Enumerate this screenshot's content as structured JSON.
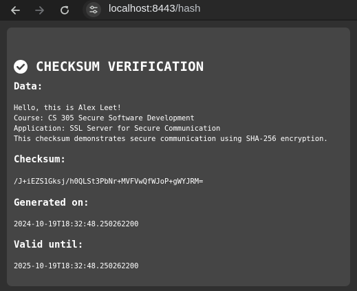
{
  "browser": {
    "host": "localhost:8443",
    "path": "/hash"
  },
  "page": {
    "title": "CHECKSUM VERIFICATION",
    "data_heading": "Data:",
    "data_lines": [
      "Hello, this is Alex Leet!",
      "Course: CS 305 Secure Software Development",
      "Application: SSL Server for Secure Communication",
      "This checksum demonstrates secure communication using SHA-256 encryption."
    ],
    "checksum_heading": "Checksum:",
    "checksum_value": "/J+iEZS1Gksj/h0QLSt3PbNr+MVFVwQfWJoP+gWYJRM=",
    "generated_heading": "Generated on:",
    "generated_value": "2024-10-19T18:32:48.250262200",
    "valid_heading": "Valid until:",
    "valid_value": "2025-10-19T18:32:48.250262200"
  },
  "colors": {
    "page_background": "#303030",
    "card_background": "#454545",
    "text": "#ffffff"
  },
  "icons": {
    "back": "arrow-left-icon",
    "forward": "arrow-right-icon",
    "reload": "reload-icon",
    "site_info": "tune-icon",
    "title": "check-circle-icon"
  }
}
